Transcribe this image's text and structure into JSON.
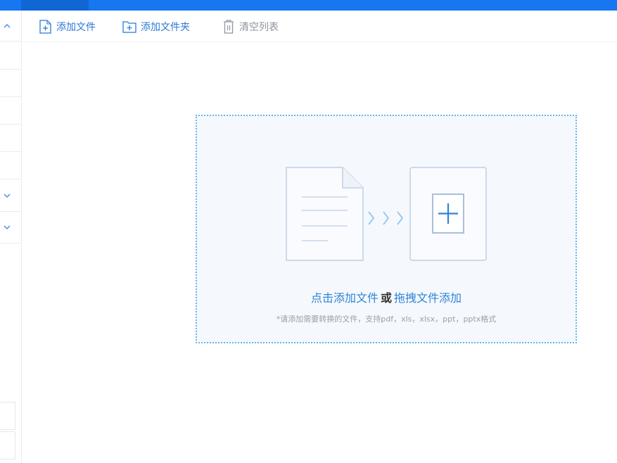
{
  "toolbar": {
    "add_file_label": "添加文件",
    "add_folder_label": "添加文件夹",
    "clear_list_label": "清空列表"
  },
  "dropzone": {
    "click_add_text": "点击添加文件",
    "or_text": "或",
    "drag_add_text": "拖拽文件添加",
    "hint_text": "*请添加需要转换的文件，支持pdf，xls，xlsx，ppt，pptx格式"
  },
  "icons": {
    "add_file": "file-plus-icon",
    "add_folder": "folder-plus-icon",
    "clear_list": "trash-icon",
    "document": "document-icon",
    "arrows": "chevron-right-icon",
    "target": "plus-box-icon"
  },
  "colors": {
    "titlebar": "#1677f0",
    "accent_blue": "#2b78d8",
    "link_blue": "#2f83d6",
    "dropzone_border": "#66b6ec",
    "dropzone_bg": "#f5f9fd",
    "muted_gray": "#8e959e"
  }
}
